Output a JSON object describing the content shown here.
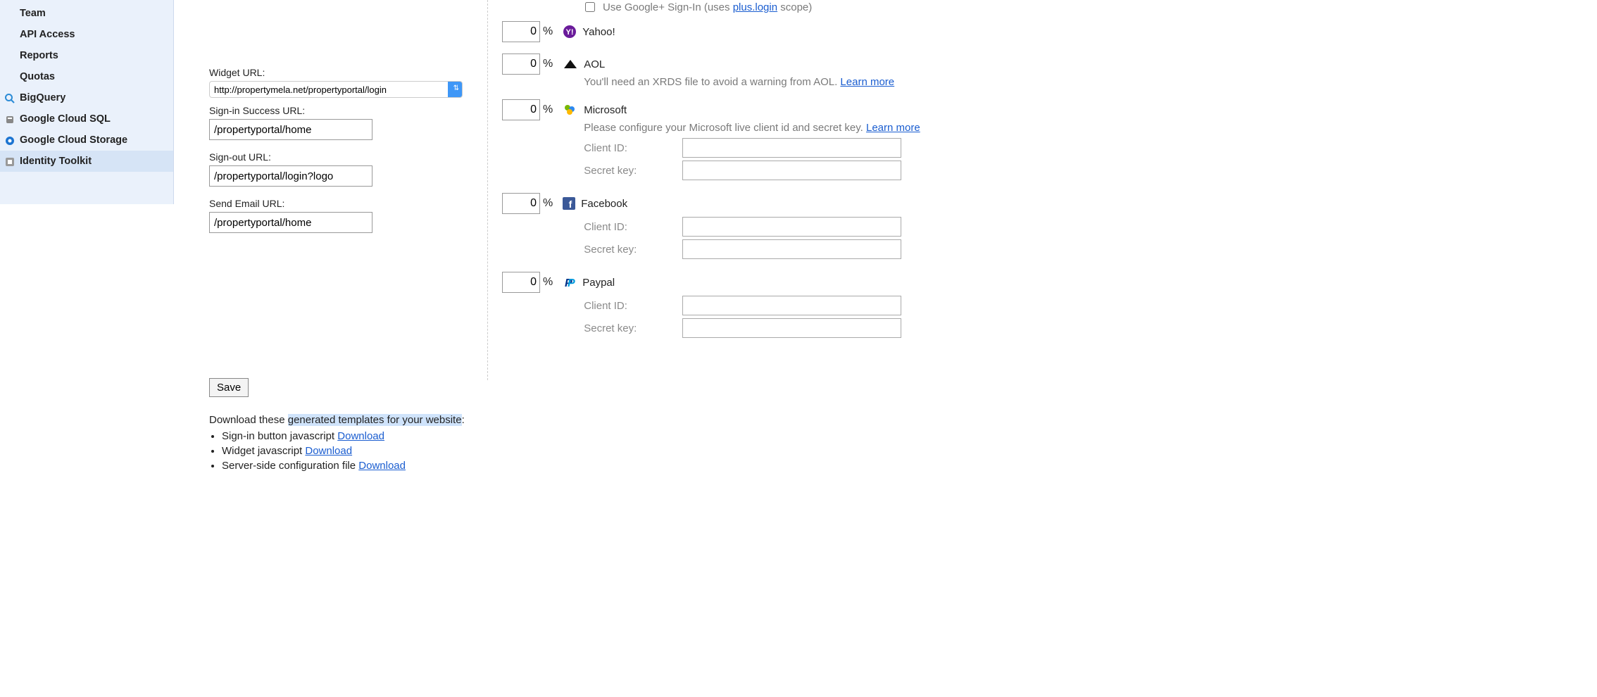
{
  "sidebar": {
    "items": [
      {
        "label": "Team",
        "icon": null
      },
      {
        "label": "API Access",
        "icon": null
      },
      {
        "label": "Reports",
        "icon": null
      },
      {
        "label": "Quotas",
        "icon": null
      },
      {
        "label": "BigQuery",
        "icon": "search-icon"
      },
      {
        "label": "Google Cloud SQL",
        "icon": "db-icon"
      },
      {
        "label": "Google Cloud Storage",
        "icon": "disk-icon"
      },
      {
        "label": "Identity Toolkit",
        "icon": "toolkit-icon",
        "active": true
      }
    ]
  },
  "left": {
    "widget_url_label": "Widget URL:",
    "widget_url_value": "http://propertymela.net/propertyportal/login",
    "signin_success_label": "Sign-in Success URL:",
    "signin_success_value": "/propertyportal/home",
    "signout_label": "Sign-out URL:",
    "signout_value": "/propertyportal/login?logo",
    "send_email_label": "Send Email URL:",
    "send_email_value": "/propertyportal/home",
    "save_label": "Save",
    "download_prefix": "Download these ",
    "download_highlight": "generated templates for your website",
    "download_suffix": ":",
    "downloads": [
      {
        "text": "Sign-in button javascript ",
        "link": "Download"
      },
      {
        "text": "Widget javascript ",
        "link": "Download"
      },
      {
        "text": "Server-side configuration file ",
        "link": "Download"
      }
    ]
  },
  "right": {
    "google_plus_label": "Use Google+ Sign-In (uses ",
    "google_plus_link": "plus.login",
    "google_plus_after": " scope)",
    "learn_more": "Learn more",
    "client_id_label": "Client ID:",
    "secret_key_label": "Secret key:",
    "idps": {
      "yahoo": {
        "pct": "0",
        "name": "Yahoo!"
      },
      "aol": {
        "pct": "0",
        "name": "AOL",
        "sub": "You'll need an XRDS file to avoid a warning from AOL. "
      },
      "msft": {
        "pct": "0",
        "name": "Microsoft",
        "sub": "Please configure your Microsoft live client id and secret key. ",
        "client_id": "",
        "secret": ""
      },
      "fb": {
        "pct": "0",
        "name": "Facebook",
        "client_id": "",
        "secret": ""
      },
      "pp": {
        "pct": "0",
        "name": "Paypal",
        "client_id": "",
        "secret": ""
      }
    }
  }
}
